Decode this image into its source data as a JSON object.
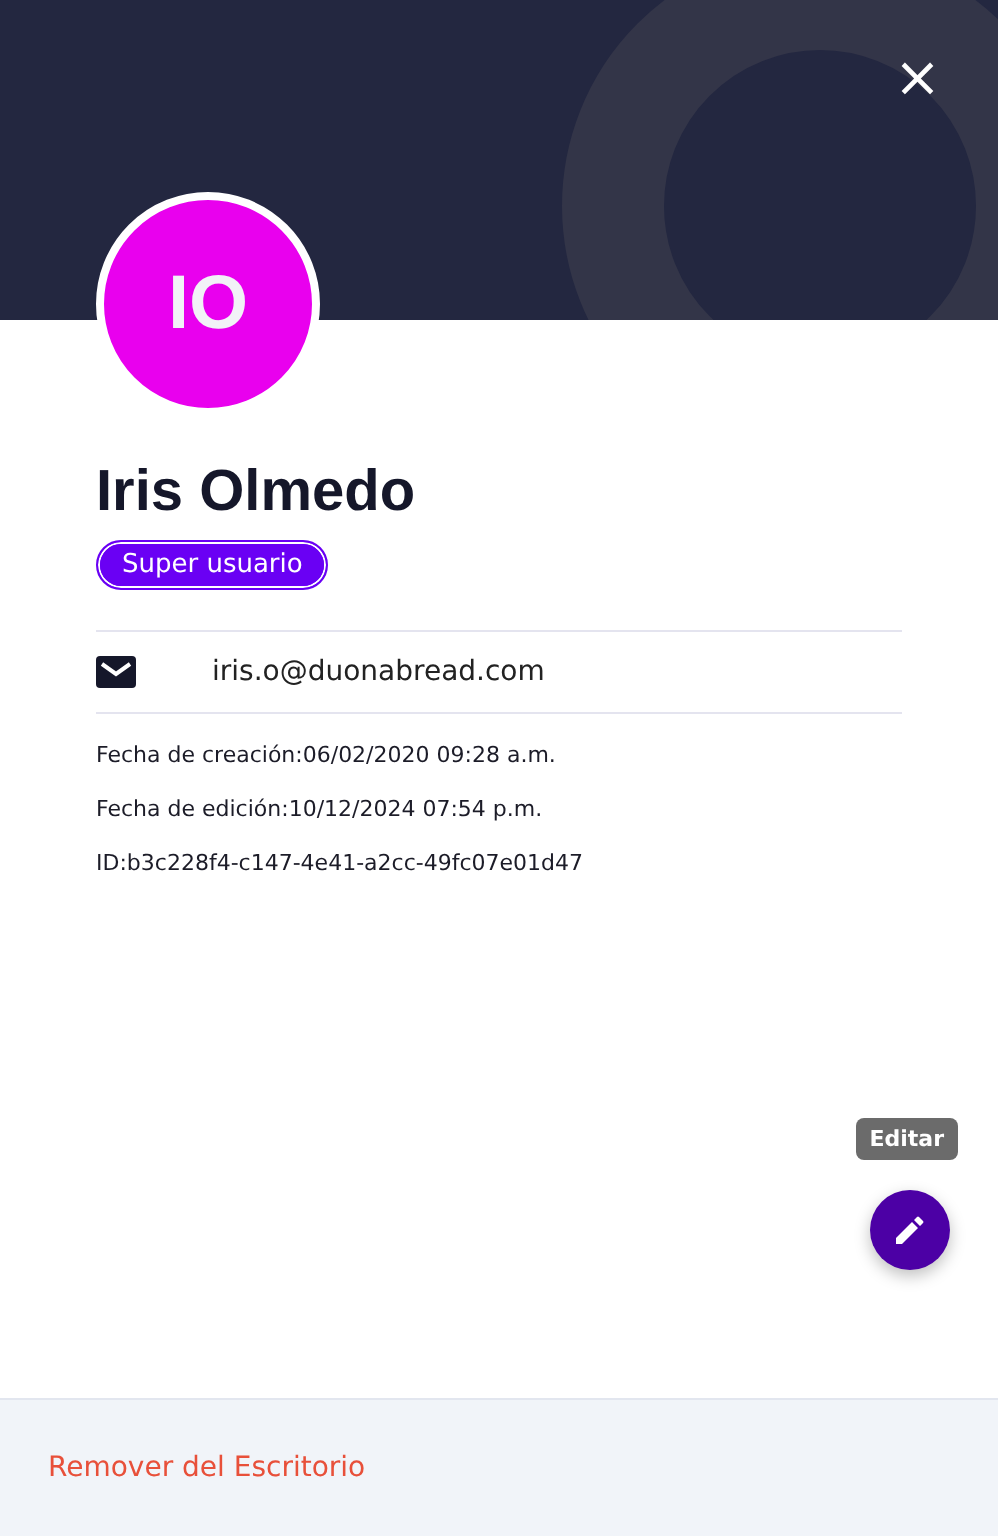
{
  "header": {
    "close": "×"
  },
  "profile": {
    "initials": "IO",
    "name": "Iris Olmedo",
    "role": "Super usuario"
  },
  "email": "iris.o@duonabread.com",
  "meta": [
    {
      "label": "Fecha de creación:",
      "value": "06/02/2020 09:28 a.m."
    },
    {
      "label": "Fecha de edición:",
      "value": "10/12/2024 07:54 p.m."
    },
    {
      "label": "ID:",
      "value": "b3c228f4-c147-4e41-a2cc-49fc07e01d47"
    }
  ],
  "edit_tooltip": "Editar",
  "footer": {
    "action": "Remover del Escritorio"
  }
}
